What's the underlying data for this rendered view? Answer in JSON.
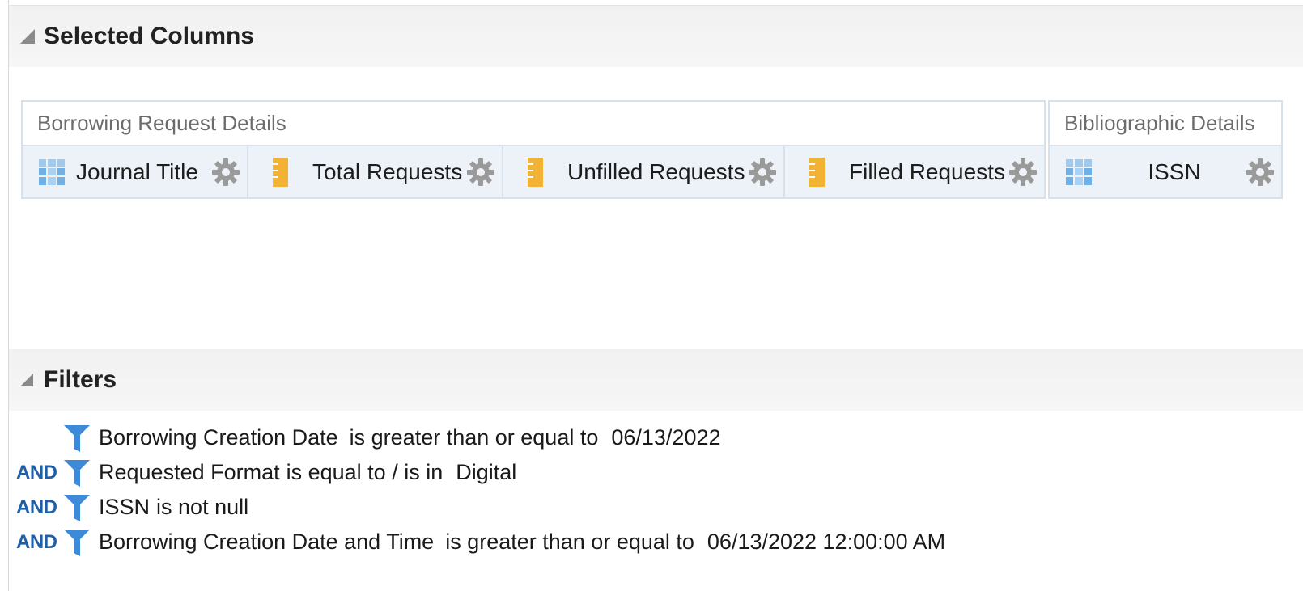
{
  "selected_columns": {
    "title": "Selected Columns",
    "groups": [
      {
        "label": "Borrowing Request Details",
        "columns": [
          {
            "name": "Journal Title",
            "kind": "attribute"
          },
          {
            "name": "Total Requests",
            "kind": "measure"
          },
          {
            "name": "Unfilled Requests",
            "kind": "measure"
          },
          {
            "name": "Filled Requests",
            "kind": "measure"
          }
        ]
      },
      {
        "label": "Bibliographic Details",
        "columns": [
          {
            "name": "ISSN",
            "kind": "attribute"
          }
        ]
      }
    ]
  },
  "filters": {
    "title": "Filters",
    "items": [
      {
        "connector": "",
        "column": "Borrowing Creation Date",
        "operator": "is greater than or equal to",
        "value": "06/13/2022"
      },
      {
        "connector": "AND",
        "column": "Requested Format",
        "operator": "is equal to / is in",
        "value": "Digital"
      },
      {
        "connector": "AND",
        "column": "ISSN",
        "operator": "is not null",
        "value": ""
      },
      {
        "connector": "AND",
        "column": "Borrowing Creation Date and Time",
        "operator": "is greater than or equal to",
        "value": "06/13/2022 12:00:00 AM"
      }
    ]
  },
  "colors": {
    "accent": "#1f5fa8",
    "funnel": "#3d8ad8",
    "measure": "#f2b233",
    "attribute": "#6fb0e6",
    "gear": "#9a9a9a"
  }
}
